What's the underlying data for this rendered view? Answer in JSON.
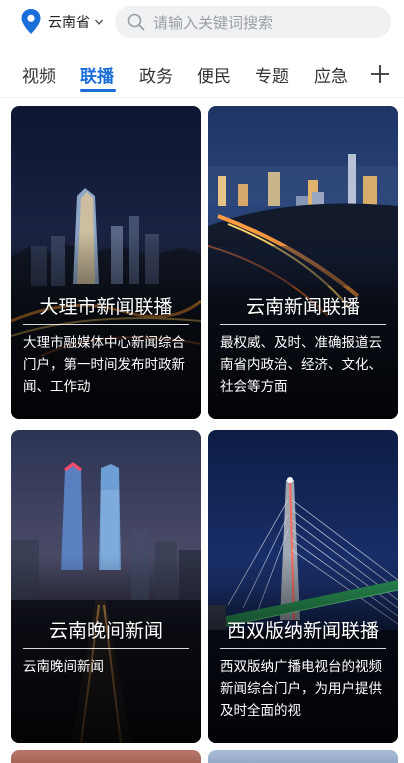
{
  "location": {
    "name": "云南省"
  },
  "search": {
    "placeholder": "请输入关键词搜索"
  },
  "tabs": [
    {
      "label": "视频",
      "active": false
    },
    {
      "label": "联播",
      "active": true
    },
    {
      "label": "政务",
      "active": false
    },
    {
      "label": "便民",
      "active": false
    },
    {
      "label": "专题",
      "active": false
    },
    {
      "label": "应急",
      "active": false
    }
  ],
  "tab_add_icon": "plus-icon",
  "accent_color": "#1a6ed8",
  "cards": [
    {
      "title": "大理市新闻联播",
      "desc": "大理市融媒体中心新闻综合门户，第一时间发布时政新闻、工作动"
    },
    {
      "title": "云南新闻联播",
      "desc": "最权威、及时、准确报道云南省内政治、经济、文化、社会等方面"
    },
    {
      "title": "云南晚间新闻",
      "desc": "云南晚间新闻"
    },
    {
      "title": "西双版纳新闻联播",
      "desc": "西双版纳广播电视台的视频新闻综合门户，为用户提供及时全面的视"
    }
  ]
}
